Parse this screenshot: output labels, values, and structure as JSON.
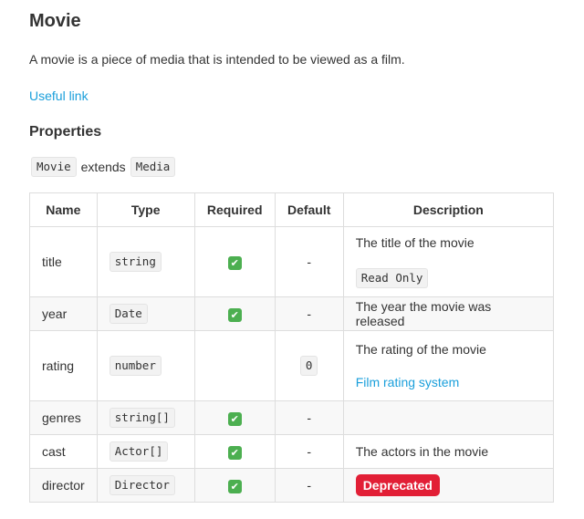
{
  "page": {
    "title": "Movie",
    "description": "A movie is a piece of media that is intended to be viewed as a film.",
    "useful_link": "Useful link",
    "properties_heading": "Properties",
    "extends": {
      "type": "Movie",
      "keyword": "extends",
      "base": "Media"
    }
  },
  "table": {
    "headers": [
      "Name",
      "Type",
      "Required",
      "Default",
      "Description"
    ],
    "check_icon": "check-mark-icon",
    "rows": [
      {
        "name": "title",
        "type": "string",
        "required": "✔",
        "default": "-",
        "description": "The title of the movie",
        "extra_code": "Read Only"
      },
      {
        "name": "year",
        "type": "Date",
        "required": "✔",
        "default": "-",
        "description": "The year the movie was released"
      },
      {
        "name": "rating",
        "type": "number",
        "required": "",
        "default": "0",
        "description": "The rating of the movie",
        "link": "Film rating system"
      },
      {
        "name": "genres",
        "type": "string[]",
        "required": "✔",
        "default": "-",
        "description": ""
      },
      {
        "name": "cast",
        "type": "Actor[]",
        "required": "✔",
        "default": "-",
        "description": "The actors in the movie"
      },
      {
        "name": "director",
        "type": "Director",
        "required": "✔",
        "default": "-",
        "badge": "Deprecated"
      }
    ]
  },
  "colors": {
    "link": "#1a9fdb",
    "check": "#4caf50",
    "deprecated": "#e21f36"
  }
}
